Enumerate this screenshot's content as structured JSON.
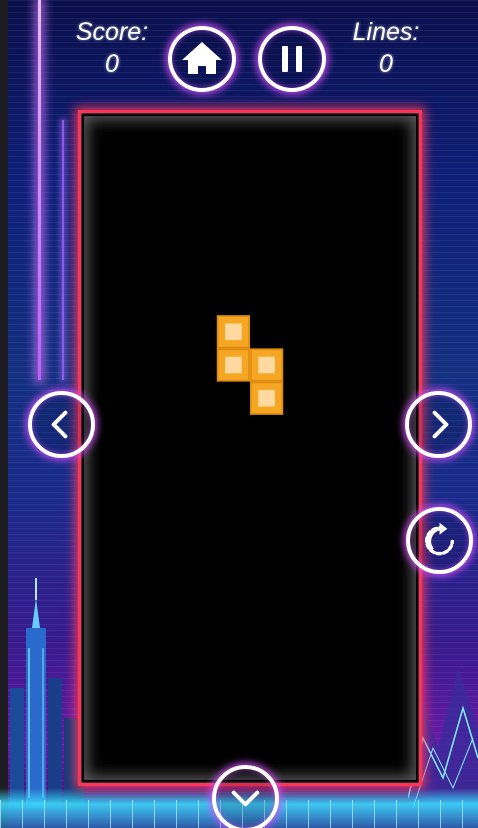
{
  "hud": {
    "score_label": "Score:",
    "score_value": "0",
    "lines_label": "Lines:",
    "lines_value": "0"
  },
  "buttons": {
    "home_icon": "home-icon",
    "pause_icon": "pause-icon",
    "left_icon": "chevron-left-icon",
    "right_icon": "chevron-right-icon",
    "rotate_icon": "rotate-icon",
    "down_icon": "chevron-down-icon"
  },
  "board": {
    "columns": 10,
    "rows": 20,
    "border_color": "#ff3355",
    "active_piece": {
      "type": "S",
      "color": "#f5a623",
      "highlight_color": "#ffd9a0",
      "cells": [
        [
          4,
          6
        ],
        [
          4,
          7
        ],
        [
          5,
          7
        ],
        [
          5,
          8
        ]
      ]
    }
  },
  "colors": {
    "accent_glow": "#dc50ff",
    "text": "#ffffff"
  }
}
